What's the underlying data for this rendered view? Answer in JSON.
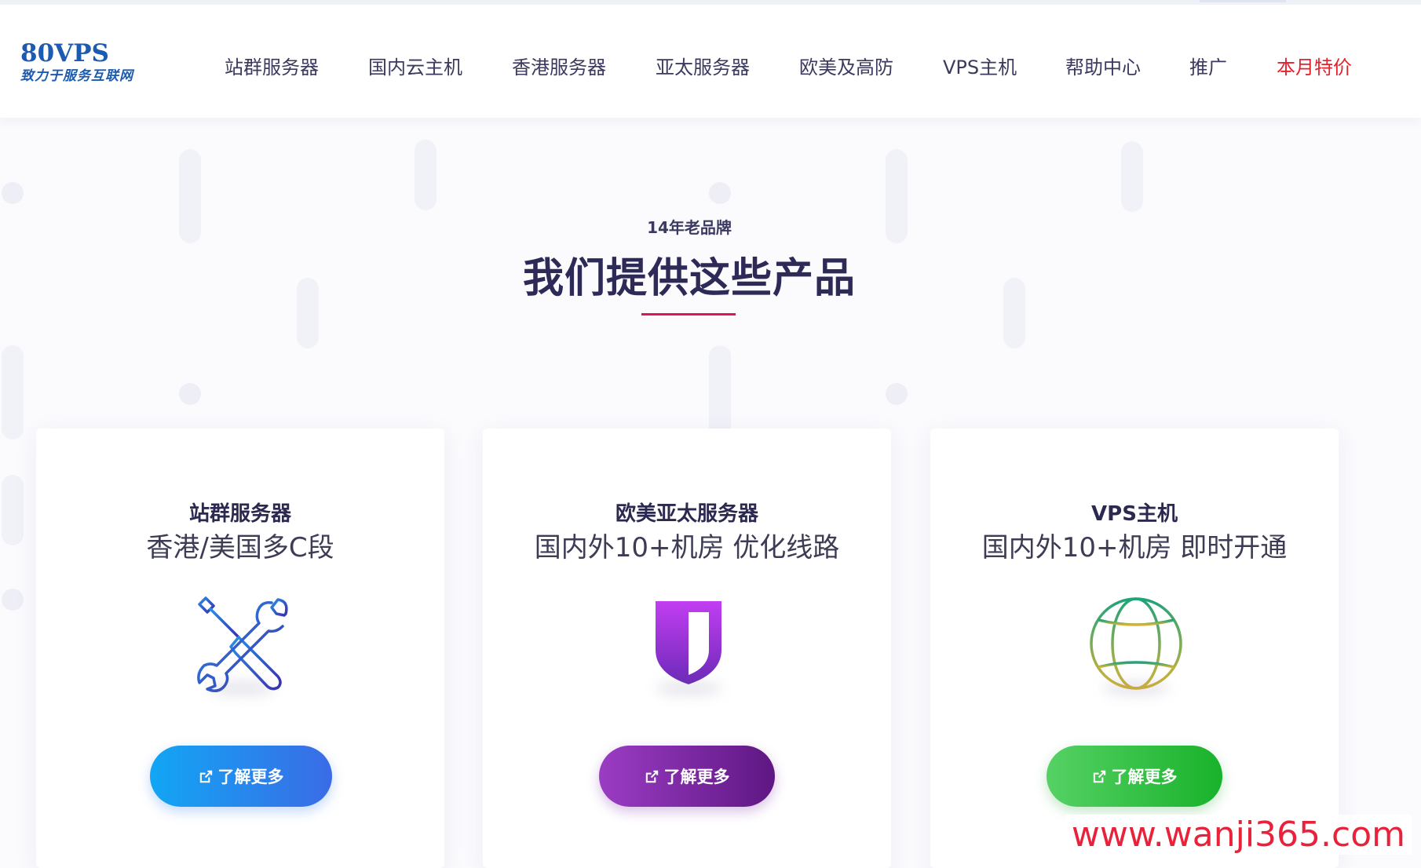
{
  "header": {
    "logo": {
      "main": "80VPS",
      "sub": "致力于服务互联网"
    },
    "nav": [
      {
        "label": "站群服务器"
      },
      {
        "label": "国内云主机"
      },
      {
        "label": "香港服务器"
      },
      {
        "label": "亚太服务器"
      },
      {
        "label": "欧美及高防"
      },
      {
        "label": "VPS主机"
      },
      {
        "label": "帮助中心"
      },
      {
        "label": "推广"
      },
      {
        "label": "本月特价"
      }
    ]
  },
  "section": {
    "eyebrow": "14年老品牌",
    "headline": "我们提供这些产品"
  },
  "cards": [
    {
      "title": "站群服务器",
      "subtitle": "香港/美国多C段",
      "icon": "tools-icon",
      "button": "了解更多"
    },
    {
      "title": "欧美亚太服务器",
      "subtitle": "国内外10+机房 优化线路",
      "icon": "shield-icon",
      "button": "了解更多"
    },
    {
      "title": "VPS主机",
      "subtitle": "国内外10+机房 即时开通",
      "icon": "globe-icon",
      "button": "了解更多"
    }
  ],
  "watermark": "www.wanji365.com",
  "colors": {
    "accent_red": "#e3232c",
    "title_underline": "#e0145a",
    "btn_blue": "#2f86ee",
    "btn_purple": "#7a2aa6",
    "btn_green": "#2fbf3f"
  }
}
